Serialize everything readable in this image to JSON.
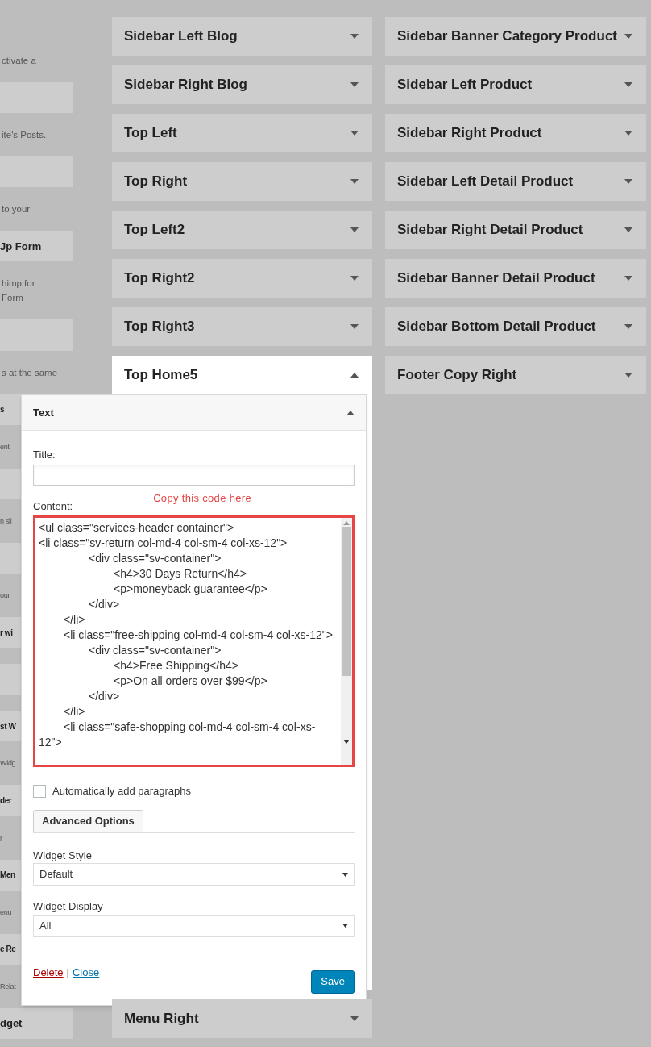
{
  "left_column": [
    {
      "kind": "text",
      "text": "ctivate a"
    },
    {
      "kind": "tile"
    },
    {
      "kind": "text",
      "text": "ite's Posts."
    },
    {
      "kind": "tile"
    },
    {
      "kind": "text",
      "text": "to your"
    },
    {
      "kind": "tile",
      "label": "Jp Form"
    },
    {
      "kind": "text",
      "text": "himp for\nForm"
    },
    {
      "kind": "tile"
    },
    {
      "kind": "text",
      "text": "s at the same"
    },
    {
      "kind": "tile",
      "label": "s"
    },
    {
      "kind": "text",
      "text": "ent"
    },
    {
      "kind": "tile"
    },
    {
      "kind": "text",
      "text": "n sli"
    },
    {
      "kind": "tile"
    },
    {
      "kind": "text",
      "text": "our"
    },
    {
      "kind": "tile",
      "label": "r wi"
    },
    {
      "kind": "tile"
    },
    {
      "kind": "tile",
      "label": "st W"
    },
    {
      "kind": "text",
      "text": "Widg"
    },
    {
      "kind": "tile",
      "label": "der"
    },
    {
      "kind": "text",
      "text": "r"
    },
    {
      "kind": "tile",
      "label": "Men"
    },
    {
      "kind": "text",
      "text": "enu"
    },
    {
      "kind": "tile",
      "label": "e Re"
    },
    {
      "kind": "text",
      "text": "Relat"
    },
    {
      "kind": "tile",
      "label": "dget"
    }
  ],
  "middle_column": [
    {
      "title": "Sidebar Left Blog",
      "expanded": false
    },
    {
      "title": "Sidebar Right Blog",
      "expanded": false
    },
    {
      "title": "Top Left",
      "expanded": false
    },
    {
      "title": "Top Right",
      "expanded": false
    },
    {
      "title": "Top Left2",
      "expanded": false
    },
    {
      "title": "Top Right2",
      "expanded": false
    },
    {
      "title": "Top Right3",
      "expanded": false
    },
    {
      "title": "Top Home5",
      "expanded": true
    },
    {
      "title": "Menu Right",
      "expanded": false
    }
  ],
  "right_column": [
    {
      "title": "Sidebar Banner Category Product",
      "expanded": false
    },
    {
      "title": "Sidebar Left Product",
      "expanded": false
    },
    {
      "title": "Sidebar Right Product",
      "expanded": false
    },
    {
      "title": "Sidebar Left Detail Product",
      "expanded": false
    },
    {
      "title": "Sidebar Right Detail Product",
      "expanded": false
    },
    {
      "title": "Sidebar Banner Detail Product",
      "expanded": false
    },
    {
      "title": "Sidebar Bottom Detail Product",
      "expanded": false
    },
    {
      "title": "Footer Copy Right",
      "expanded": false
    }
  ],
  "widget": {
    "title": "Text",
    "expanded": true,
    "title_label": "Title:",
    "content_label": "Content:",
    "annotation": "Copy this code here",
    "content": "<ul class=\"services-header container\">\n<li class=\"sv-return col-md-4 col-sm-4 col-xs-12\">\n\t\t<div class=\"sv-container\">\n\t\t\t<h4>30 Days Return</h4>\n\t\t\t<p>moneyback guarantee</p>\n\t\t</div>\n\t</li>\n\t<li class=\"free-shipping col-md-4 col-sm-4 col-xs-12\">\n\t\t<div class=\"sv-container\">\n\t\t\t<h4>Free Shipping</h4>\n\t\t\t<p>On all orders over $99</p>\n\t\t</div>\n\t</li>\n\t<li class=\"safe-shopping col-md-4 col-sm-4 col-xs-12\">",
    "auto_paragraphs": {
      "label": "Automatically add paragraphs",
      "checked": false
    },
    "advanced_button": "Advanced Options",
    "selects": [
      {
        "label": "Widget Style",
        "value": "Default"
      },
      {
        "label": "Widget Display",
        "value": "All"
      }
    ],
    "delete_link": "Delete",
    "separator": "|",
    "close_link": "Close",
    "save_button": "Save"
  }
}
